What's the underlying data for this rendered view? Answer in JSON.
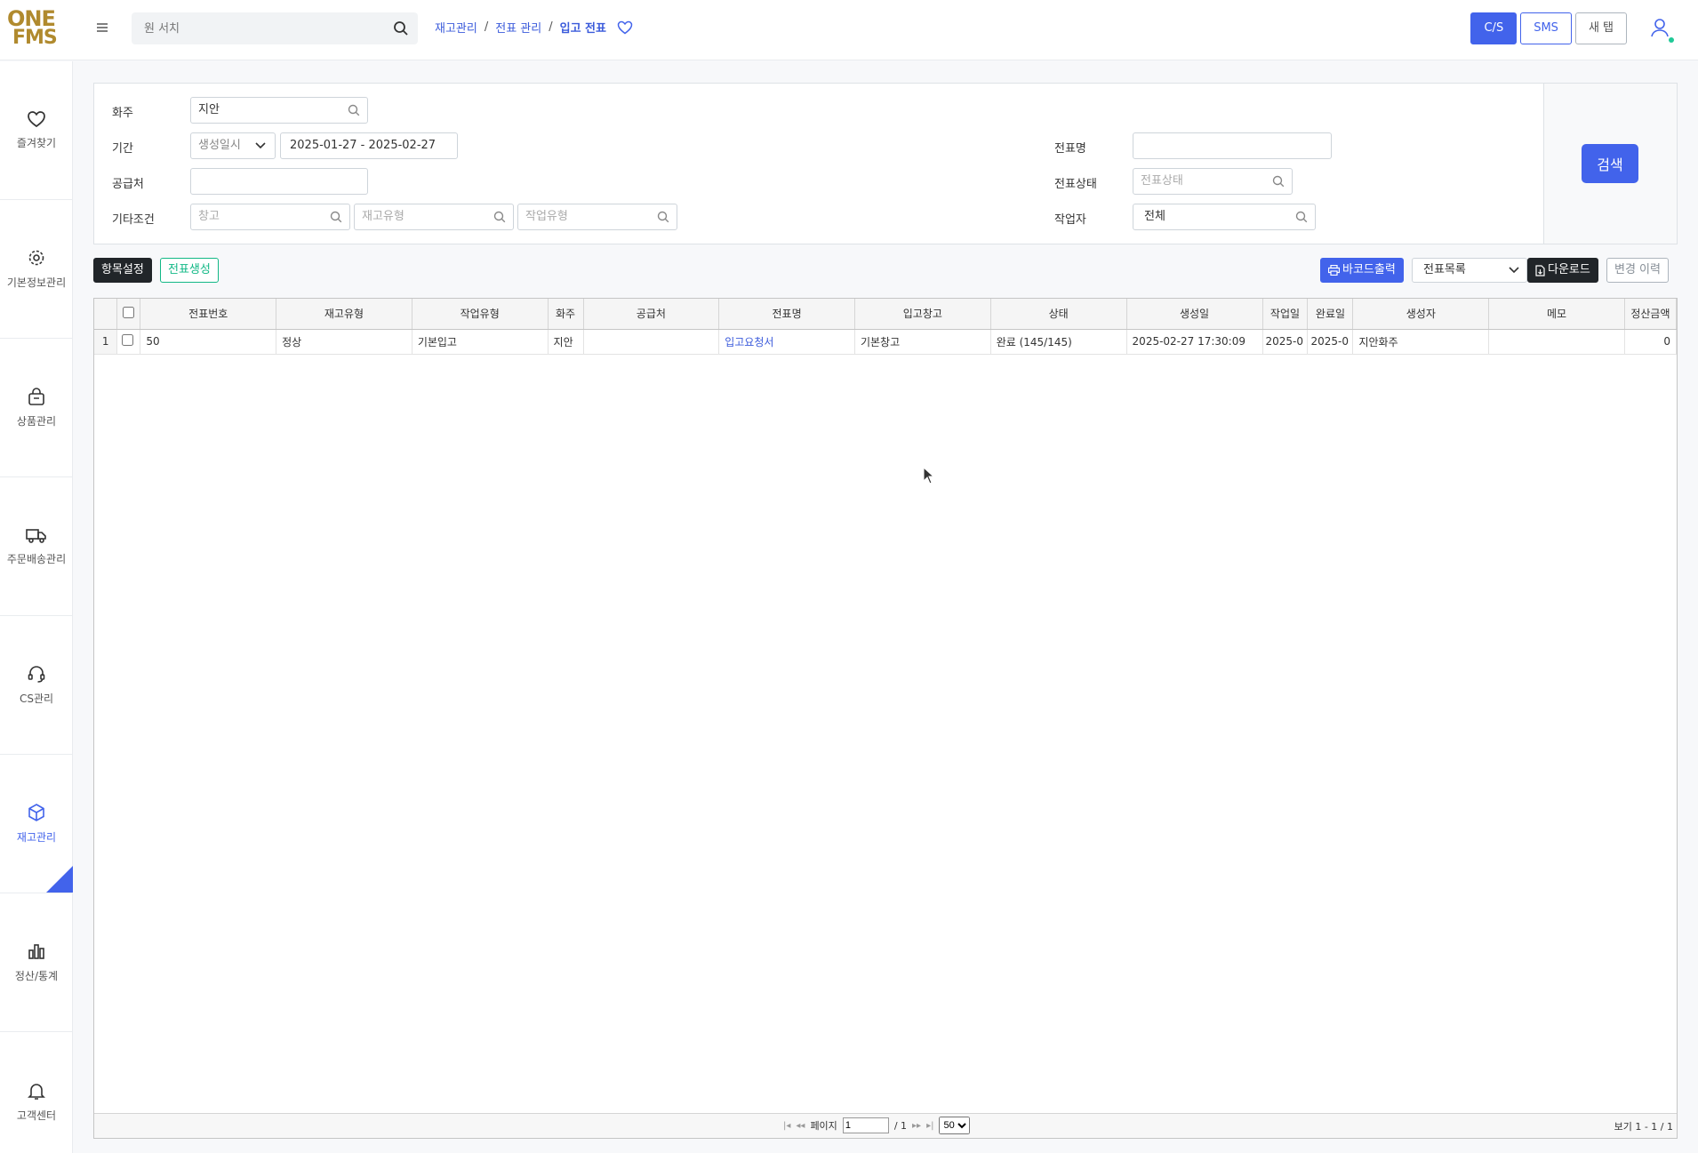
{
  "header": {
    "logo_line1": "ONE",
    "logo_line2": "FMS",
    "search_placeholder": "원 서치",
    "breadcrumb": [
      "재고관리",
      "전표 관리",
      "입고 전표"
    ],
    "buttons": {
      "cs": "C/S",
      "sms": "SMS",
      "new_tab": "새 탭"
    }
  },
  "sidebar": {
    "items": [
      {
        "label": "즐겨찾기",
        "icon": "heart-icon"
      },
      {
        "label": "기본정보관리",
        "icon": "gear-icon"
      },
      {
        "label": "상품관리",
        "icon": "bag-icon"
      },
      {
        "label": "주문배송관리",
        "icon": "truck-icon"
      },
      {
        "label": "CS관리",
        "icon": "headset-icon"
      },
      {
        "label": "재고관리",
        "icon": "box-icon",
        "active": true
      },
      {
        "label": "정산/통계",
        "icon": "bar-chart-icon"
      },
      {
        "label": "고객센터",
        "icon": "bell-icon"
      }
    ]
  },
  "filter": {
    "shipper_label": "화주",
    "shipper_value": "지안",
    "period_label": "기간",
    "period_type": "생성일시",
    "period_range": "2025-01-27 - 2025-02-27",
    "supplier_label": "공급처",
    "supplier_value": "",
    "other_label": "기타조건",
    "other_warehouse_placeholder": "창고",
    "other_stock_type_placeholder": "재고유형",
    "other_work_type_placeholder": "작업유형",
    "slip_name_label": "전표명",
    "slip_name_value": "",
    "slip_status_label": "전표상태",
    "slip_status_placeholder": "전표상태",
    "worker_label": "작업자",
    "worker_value": "전체",
    "search_button": "검색"
  },
  "toolbar": {
    "column_settings": "항목설정",
    "create_slip": "전표생성",
    "barcode_print": "바코드출력",
    "slip_list_select": "전표목록",
    "download": "다운로드",
    "change_history": "변경 이력"
  },
  "grid": {
    "columns": [
      "전표번호",
      "재고유형",
      "작업유형",
      "화주",
      "공급처",
      "전표명",
      "입고창고",
      "상태",
      "생성일",
      "작업일",
      "완료일",
      "생성자",
      "메모",
      "정산금액"
    ],
    "rows": [
      {
        "row_num": "1",
        "slip_no": "50",
        "stock_type": "정상",
        "work_type": "기본입고",
        "shipper": "지안",
        "supplier": "",
        "slip_name": "입고요청서",
        "warehouse": "기본창고",
        "status": "완료 (145/145)",
        "created": "2025-02-27 17:30:09",
        "work_date": "2025-0",
        "done_date": "2025-0",
        "creator": "지안화주",
        "memo": "",
        "amount": "0"
      }
    ],
    "pager": {
      "page_label": "페이지",
      "page_value": "1",
      "total_pages": "/ 1",
      "page_size": "50",
      "summary": "보기 1 - 1 / 1"
    }
  },
  "colors": {
    "accent": "#4263eb",
    "brand": "#b08a2e",
    "green": "#12b886"
  }
}
